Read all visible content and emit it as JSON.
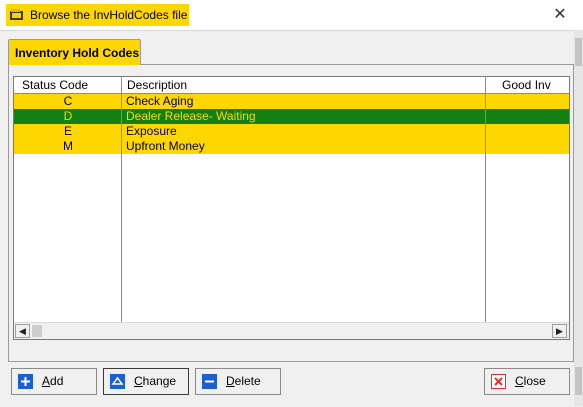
{
  "window": {
    "title": "Browse the InvHoldCodes file",
    "close_glyph": "✕"
  },
  "tab": {
    "label": "Inventory Hold Codes"
  },
  "columns": [
    "Status Code",
    "Description",
    "Good Inv"
  ],
  "rows": [
    {
      "code": "C",
      "description": "Check Aging",
      "good_inv": "",
      "selected": false
    },
    {
      "code": "D",
      "description": "Dealer Release- Waiting",
      "good_inv": "",
      "selected": true
    },
    {
      "code": "E",
      "description": "Exposure",
      "good_inv": "",
      "selected": false
    },
    {
      "code": "M",
      "description": "Upfront Money",
      "good_inv": "",
      "selected": false
    }
  ],
  "buttons": {
    "add": {
      "hotkey": "A",
      "rest": "dd",
      "icon": "plus-icon"
    },
    "change": {
      "hotkey": "C",
      "rest": "hange",
      "icon": "triangle-up-icon"
    },
    "delete": {
      "hotkey": "D",
      "rest": "elete",
      "icon": "minus-icon"
    },
    "close": {
      "hotkey": "C",
      "rest": "lose",
      "icon": "close-x-icon"
    }
  },
  "colors": {
    "highlight": "#ffd700",
    "selected_row_bg": "#128012",
    "selected_row_text": "#ffd700",
    "button_icon_blue": "#1c5fd0",
    "close_icon_red": "#e03030"
  }
}
